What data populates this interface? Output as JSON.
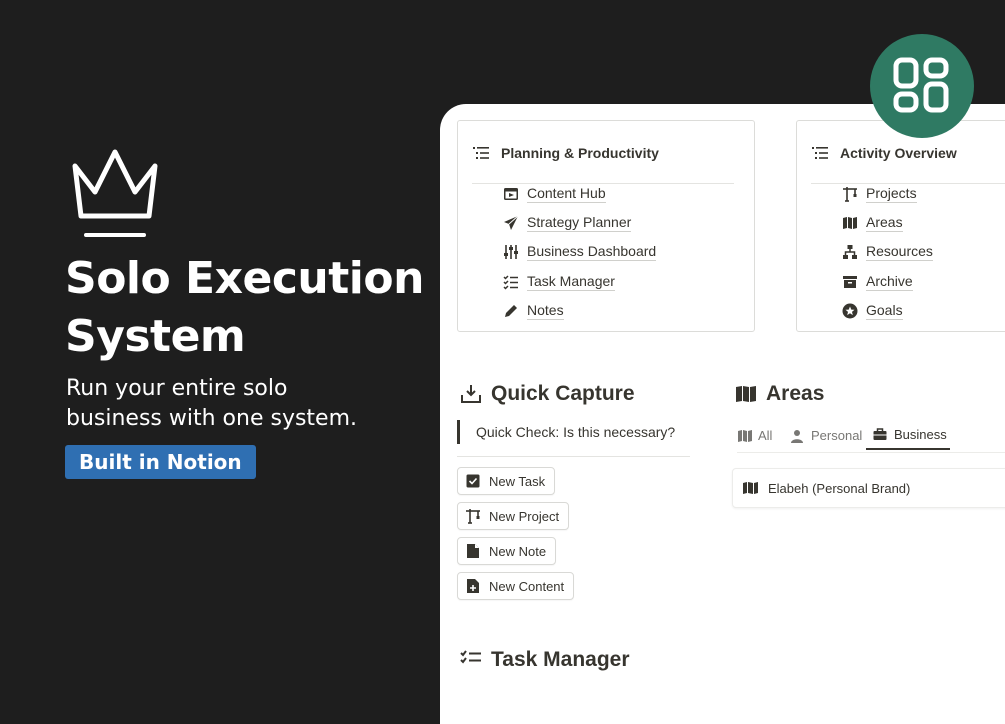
{
  "hero": {
    "title_line1": "Solo Execution",
    "title_line2": "System",
    "subtitle_line1": "Run your entire solo",
    "subtitle_line2": "business with one system.",
    "badge": "Built in Notion"
  },
  "colors": {
    "background": "#1e1e1e",
    "badge": "#2f6fb2",
    "logo": "#2f7a63",
    "panel": "#ffffff",
    "text": "#37352f"
  },
  "planning": {
    "title": "Planning & Productivity",
    "icon": "list-icon",
    "items": [
      {
        "label": "Content Hub",
        "icon": "clapperboard-icon"
      },
      {
        "label": "Strategy Planner",
        "icon": "paper-plane-icon"
      },
      {
        "label": "Business Dashboard",
        "icon": "sliders-icon"
      },
      {
        "label": "Task Manager",
        "icon": "checklist-icon"
      },
      {
        "label": "Notes",
        "icon": "pencil-icon"
      }
    ]
  },
  "activity": {
    "title": "Activity Overview",
    "icon": "list-icon",
    "items": [
      {
        "label": "Projects",
        "icon": "crane-icon"
      },
      {
        "label": "Areas",
        "icon": "map-icon"
      },
      {
        "label": "Resources",
        "icon": "hierarchy-icon"
      },
      {
        "label": "Archive",
        "icon": "archive-box-icon"
      },
      {
        "label": "Goals",
        "icon": "star-circle-icon"
      }
    ]
  },
  "quick_capture": {
    "title": "Quick Capture",
    "icon": "inbox-download-icon",
    "callout": "Quick Check: Is this necessary?",
    "buttons": [
      {
        "label": "New Task",
        "icon": "checkbox-icon"
      },
      {
        "label": "New Project",
        "icon": "crane-icon"
      },
      {
        "label": "New Note",
        "icon": "document-icon"
      },
      {
        "label": "New Content",
        "icon": "document-plus-icon"
      }
    ]
  },
  "areas": {
    "title": "Areas",
    "icon": "map-icon",
    "tabs": [
      {
        "label": "All",
        "icon": "map-icon",
        "active": false
      },
      {
        "label": "Personal",
        "icon": "person-icon",
        "active": false
      },
      {
        "label": "Business",
        "icon": "briefcase-icon",
        "active": true
      }
    ],
    "cards": [
      {
        "label": "Elabeh (Personal Brand)",
        "icon": "map-icon"
      }
    ]
  },
  "task_manager": {
    "title": "Task Manager",
    "icon": "checklist-icon"
  },
  "app_logo": {
    "icon": "dashboard-grid-icon"
  }
}
